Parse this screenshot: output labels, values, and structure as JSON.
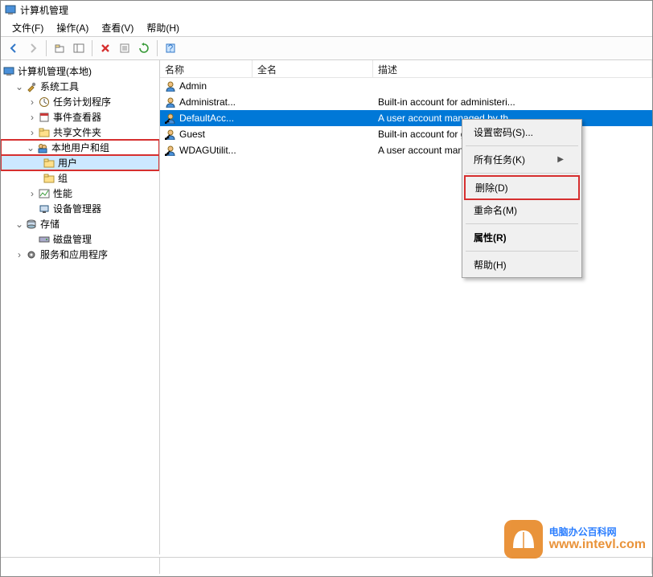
{
  "window": {
    "title": "计算机管理"
  },
  "menubar": [
    {
      "key": "file",
      "label": "文件(F)"
    },
    {
      "key": "action",
      "label": "操作(A)"
    },
    {
      "key": "view",
      "label": "查看(V)"
    },
    {
      "key": "help",
      "label": "帮助(H)"
    }
  ],
  "tree": {
    "root": "计算机管理(本地)",
    "nodes": {
      "system_tools": "系统工具",
      "task_scheduler": "任务计划程序",
      "event_viewer": "事件查看器",
      "shared_folders": "共享文件夹",
      "local_users_groups": "本地用户和组",
      "users": "用户",
      "groups": "组",
      "performance": "性能",
      "device_manager": "设备管理器",
      "storage": "存储",
      "disk_management": "磁盘管理",
      "services_apps": "服务和应用程序"
    }
  },
  "columns": {
    "name": "名称",
    "full": "全名",
    "desc": "描述"
  },
  "users": [
    {
      "name": "Admin",
      "full": "",
      "desc": ""
    },
    {
      "name": "Administrat...",
      "full": "",
      "desc": "Built-in account for administeri..."
    },
    {
      "name": "DefaultAcc...",
      "full": "",
      "desc": "A user account managed by th..."
    },
    {
      "name": "Guest",
      "full": "",
      "desc": "Built-in account for guest acce..."
    },
    {
      "name": "WDAGUtilit...",
      "full": "",
      "desc": "A user account managed and ..."
    }
  ],
  "context_menu": {
    "set_password": "设置密码(S)...",
    "all_tasks": "所有任务(K)",
    "delete": "删除(D)",
    "rename": "重命名(M)",
    "properties": "属性(R)",
    "help": "帮助(H)"
  },
  "watermark": {
    "line1": "电脑办公百科网",
    "line2": "www.intevl.com"
  }
}
